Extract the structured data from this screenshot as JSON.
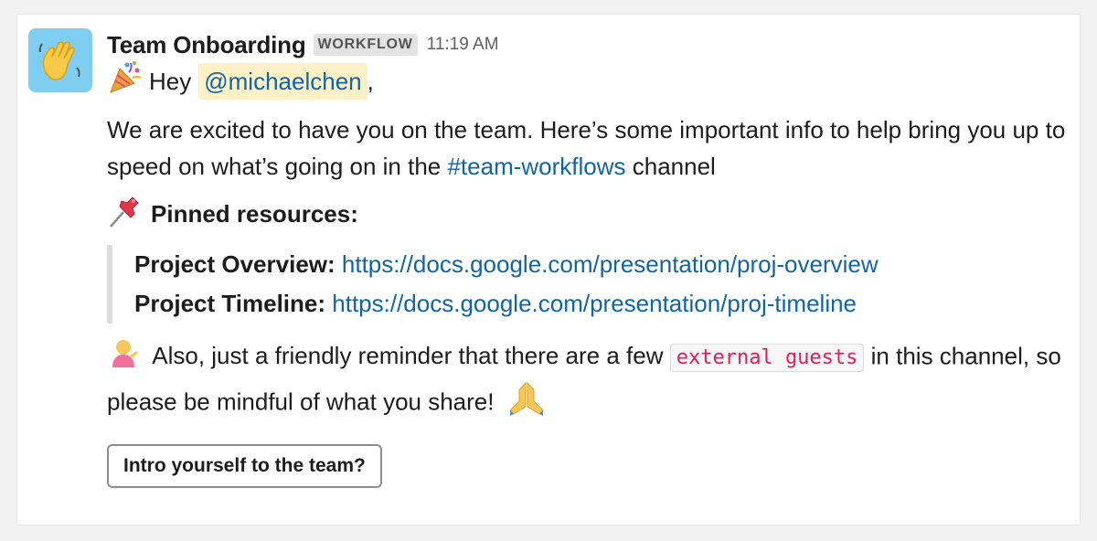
{
  "message": {
    "sender": "Team Onboarding",
    "badge": "WORKFLOW",
    "time": "11:19 AM",
    "greeting_prefix": "Hey",
    "mention": "@michaelchen",
    "greeting_suffix": ",",
    "intro_text": "We are excited to have you on the team. Here’s some important info to help bring you up to speed on what’s going on in the ",
    "channel_link": "#team-workflows",
    "intro_suffix": " channel",
    "pinned_heading": "Pinned resources:",
    "resources": [
      {
        "label": "Project Overview:",
        "url": "https://docs.google.com/presentation/proj-overview"
      },
      {
        "label": "Project Timeline:",
        "url": "https://docs.google.com/presentation/proj-timeline"
      }
    ],
    "reminder_prefix": "Also, just a friendly reminder that there are a few ",
    "reminder_code": "external guests",
    "reminder_suffix": " in this channel, so please be mindful of what you share!",
    "action_button": "Intro yourself to the team?"
  },
  "icons": {
    "avatar": "waving-hand-icon",
    "greeting": "party-popper-icon",
    "pinned": "pushpin-icon",
    "reminder": "person-tipping-hand-icon",
    "closing": "folded-hands-icon"
  },
  "colors": {
    "link": "#1264a3",
    "mention_bg": "#fdf1c8",
    "code": "#e01e5a",
    "avatar_bg": "#7fcdf0"
  }
}
